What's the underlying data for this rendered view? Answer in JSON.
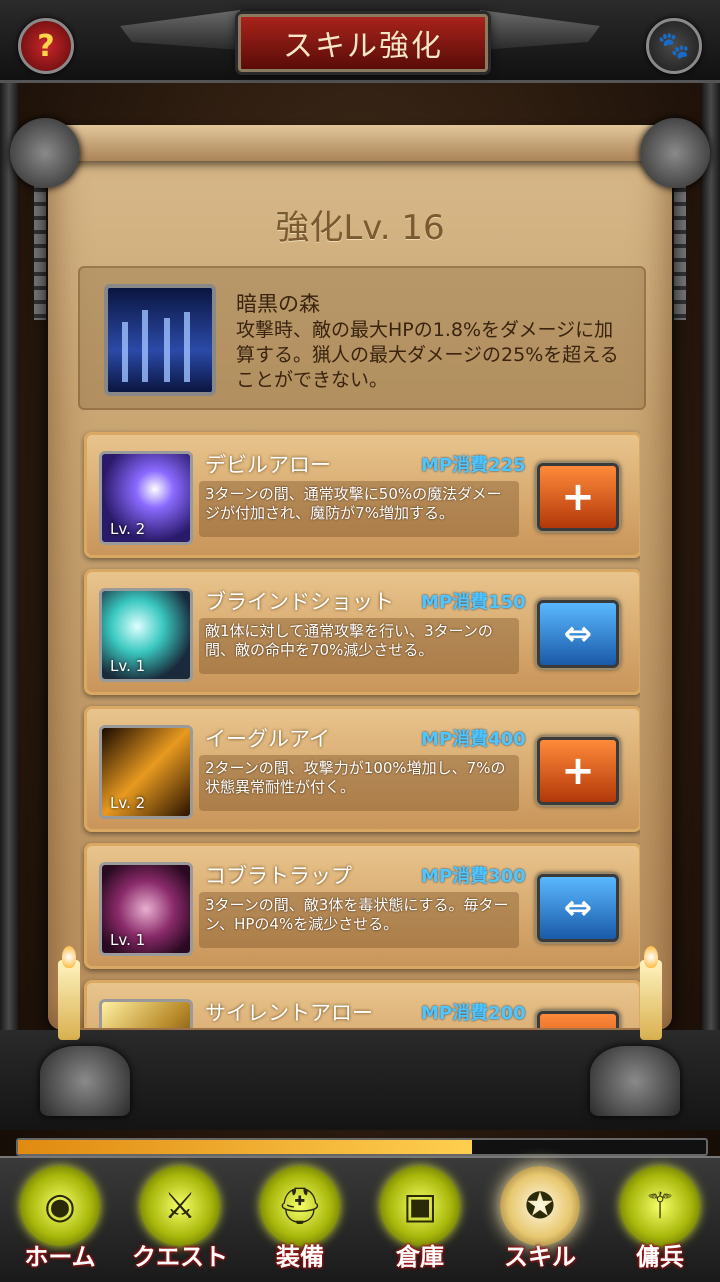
{
  "header": {
    "title": "スキル強化",
    "help_icon": "?",
    "paw_icon": "🐾"
  },
  "level_title": "強化Lv. 16",
  "featured_skill": {
    "name": "暗黒の森",
    "description": "攻撃時、敵の最大HPの1.8%をダメージに加算する。猟人の最大ダメージの25%を超えることができない。"
  },
  "skills": [
    {
      "name": "デビルアロー",
      "mp": "MP消費225",
      "level": "Lv. 2",
      "description": "3ターンの間、通常攻撃に50%の魔法ダメージが付加され、魔防が7%増加する。",
      "action": "+",
      "action_type": "plus",
      "icon_color": "#5a3ab8"
    },
    {
      "name": "ブラインドショット",
      "mp": "MP消費150",
      "level": "Lv. 1",
      "description": "敵1体に対して通常攻撃を行い、3ターンの間、敵の命中を70%減少させる。",
      "action": "⇔",
      "action_type": "swap",
      "icon_color": "#2a8a8a"
    },
    {
      "name": "イーグルアイ",
      "mp": "MP消費400",
      "level": "Lv. 2",
      "description": "2ターンの間、攻撃力が100%増加し、7%の状態異常耐性が付く。",
      "action": "+",
      "action_type": "plus",
      "icon_color": "#b86a10"
    },
    {
      "name": "コブラトラップ",
      "mp": "MP消費300",
      "level": "Lv. 1",
      "description": "3ターンの間、敵3体を毒状態にする。毎ターン、HPの4%を減少させる。",
      "action": "⇔",
      "action_type": "swap",
      "icon_color": "#8a2a6a"
    },
    {
      "name": "サイレントアロー",
      "mp": "MP消費200",
      "level": "",
      "description": "",
      "action": "+",
      "action_type": "plus",
      "icon_color": "#b88a2a"
    }
  ],
  "progress": 0.66,
  "nav": [
    {
      "label": "ホーム",
      "icon": "◉",
      "active": false
    },
    {
      "label": "クエスト",
      "icon": "⚔",
      "active": false
    },
    {
      "label": "装備",
      "icon": "⛑",
      "active": false
    },
    {
      "label": "倉庫",
      "icon": "▣",
      "active": false
    },
    {
      "label": "スキル",
      "icon": "✪",
      "active": true
    },
    {
      "label": "傭兵",
      "icon": "⚚",
      "active": false
    }
  ]
}
